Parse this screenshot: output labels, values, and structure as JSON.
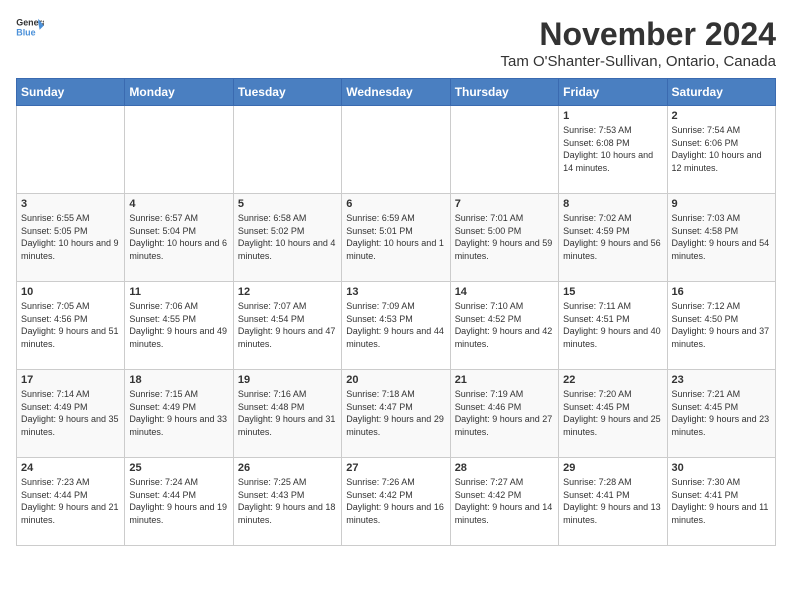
{
  "header": {
    "logo_general": "General",
    "logo_blue": "Blue",
    "title": "November 2024",
    "location": "Tam O'Shanter-Sullivan, Ontario, Canada"
  },
  "weekdays": [
    "Sunday",
    "Monday",
    "Tuesday",
    "Wednesday",
    "Thursday",
    "Friday",
    "Saturday"
  ],
  "weeks": [
    [
      {
        "day": "",
        "info": ""
      },
      {
        "day": "",
        "info": ""
      },
      {
        "day": "",
        "info": ""
      },
      {
        "day": "",
        "info": ""
      },
      {
        "day": "",
        "info": ""
      },
      {
        "day": "1",
        "info": "Sunrise: 7:53 AM\nSunset: 6:08 PM\nDaylight: 10 hours and 14 minutes."
      },
      {
        "day": "2",
        "info": "Sunrise: 7:54 AM\nSunset: 6:06 PM\nDaylight: 10 hours and 12 minutes."
      }
    ],
    [
      {
        "day": "3",
        "info": "Sunrise: 6:55 AM\nSunset: 5:05 PM\nDaylight: 10 hours and 9 minutes."
      },
      {
        "day": "4",
        "info": "Sunrise: 6:57 AM\nSunset: 5:04 PM\nDaylight: 10 hours and 6 minutes."
      },
      {
        "day": "5",
        "info": "Sunrise: 6:58 AM\nSunset: 5:02 PM\nDaylight: 10 hours and 4 minutes."
      },
      {
        "day": "6",
        "info": "Sunrise: 6:59 AM\nSunset: 5:01 PM\nDaylight: 10 hours and 1 minute."
      },
      {
        "day": "7",
        "info": "Sunrise: 7:01 AM\nSunset: 5:00 PM\nDaylight: 9 hours and 59 minutes."
      },
      {
        "day": "8",
        "info": "Sunrise: 7:02 AM\nSunset: 4:59 PM\nDaylight: 9 hours and 56 minutes."
      },
      {
        "day": "9",
        "info": "Sunrise: 7:03 AM\nSunset: 4:58 PM\nDaylight: 9 hours and 54 minutes."
      }
    ],
    [
      {
        "day": "10",
        "info": "Sunrise: 7:05 AM\nSunset: 4:56 PM\nDaylight: 9 hours and 51 minutes."
      },
      {
        "day": "11",
        "info": "Sunrise: 7:06 AM\nSunset: 4:55 PM\nDaylight: 9 hours and 49 minutes."
      },
      {
        "day": "12",
        "info": "Sunrise: 7:07 AM\nSunset: 4:54 PM\nDaylight: 9 hours and 47 minutes."
      },
      {
        "day": "13",
        "info": "Sunrise: 7:09 AM\nSunset: 4:53 PM\nDaylight: 9 hours and 44 minutes."
      },
      {
        "day": "14",
        "info": "Sunrise: 7:10 AM\nSunset: 4:52 PM\nDaylight: 9 hours and 42 minutes."
      },
      {
        "day": "15",
        "info": "Sunrise: 7:11 AM\nSunset: 4:51 PM\nDaylight: 9 hours and 40 minutes."
      },
      {
        "day": "16",
        "info": "Sunrise: 7:12 AM\nSunset: 4:50 PM\nDaylight: 9 hours and 37 minutes."
      }
    ],
    [
      {
        "day": "17",
        "info": "Sunrise: 7:14 AM\nSunset: 4:49 PM\nDaylight: 9 hours and 35 minutes."
      },
      {
        "day": "18",
        "info": "Sunrise: 7:15 AM\nSunset: 4:49 PM\nDaylight: 9 hours and 33 minutes."
      },
      {
        "day": "19",
        "info": "Sunrise: 7:16 AM\nSunset: 4:48 PM\nDaylight: 9 hours and 31 minutes."
      },
      {
        "day": "20",
        "info": "Sunrise: 7:18 AM\nSunset: 4:47 PM\nDaylight: 9 hours and 29 minutes."
      },
      {
        "day": "21",
        "info": "Sunrise: 7:19 AM\nSunset: 4:46 PM\nDaylight: 9 hours and 27 minutes."
      },
      {
        "day": "22",
        "info": "Sunrise: 7:20 AM\nSunset: 4:45 PM\nDaylight: 9 hours and 25 minutes."
      },
      {
        "day": "23",
        "info": "Sunrise: 7:21 AM\nSunset: 4:45 PM\nDaylight: 9 hours and 23 minutes."
      }
    ],
    [
      {
        "day": "24",
        "info": "Sunrise: 7:23 AM\nSunset: 4:44 PM\nDaylight: 9 hours and 21 minutes."
      },
      {
        "day": "25",
        "info": "Sunrise: 7:24 AM\nSunset: 4:44 PM\nDaylight: 9 hours and 19 minutes."
      },
      {
        "day": "26",
        "info": "Sunrise: 7:25 AM\nSunset: 4:43 PM\nDaylight: 9 hours and 18 minutes."
      },
      {
        "day": "27",
        "info": "Sunrise: 7:26 AM\nSunset: 4:42 PM\nDaylight: 9 hours and 16 minutes."
      },
      {
        "day": "28",
        "info": "Sunrise: 7:27 AM\nSunset: 4:42 PM\nDaylight: 9 hours and 14 minutes."
      },
      {
        "day": "29",
        "info": "Sunrise: 7:28 AM\nSunset: 4:41 PM\nDaylight: 9 hours and 13 minutes."
      },
      {
        "day": "30",
        "info": "Sunrise: 7:30 AM\nSunset: 4:41 PM\nDaylight: 9 hours and 11 minutes."
      }
    ]
  ]
}
